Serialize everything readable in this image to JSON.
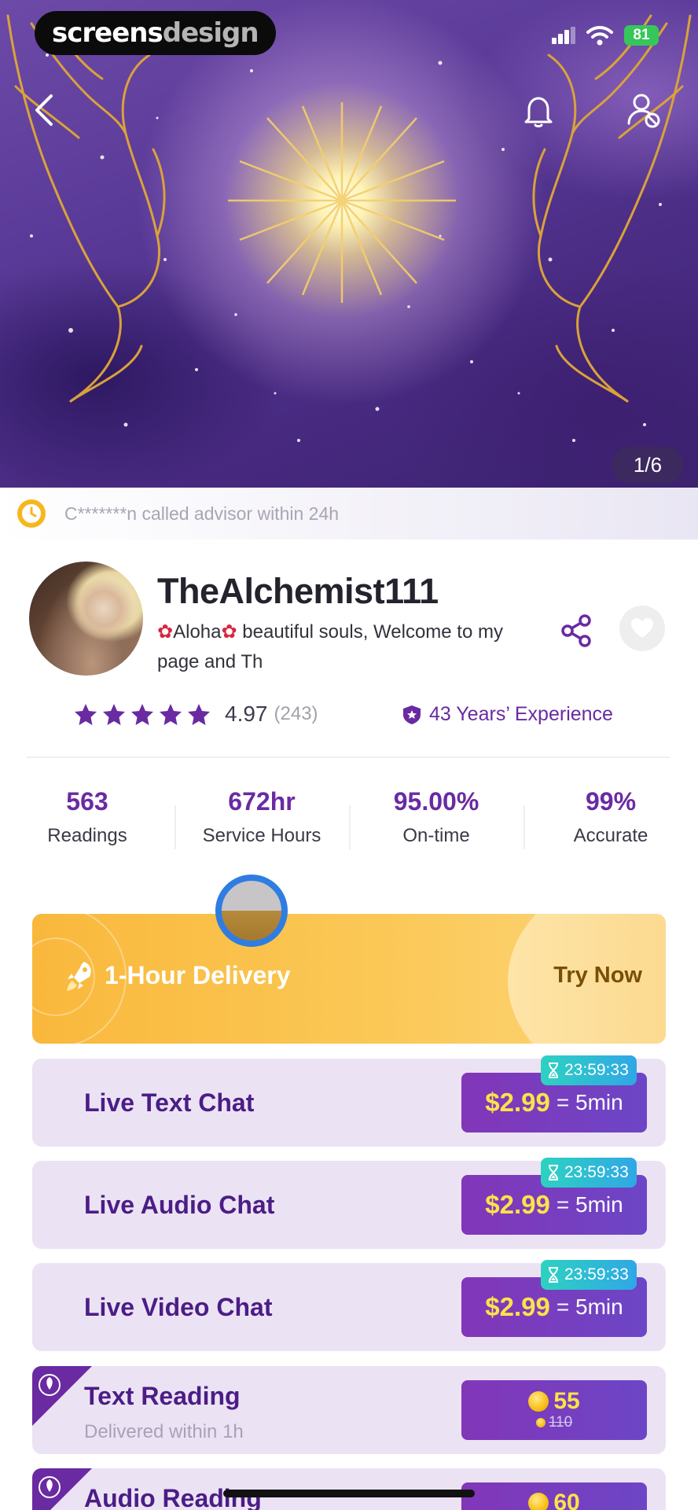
{
  "branding": {
    "part1": "screens",
    "part2": "design"
  },
  "status_bar": {
    "battery": "81"
  },
  "hero": {
    "counter": "1/6"
  },
  "notice": {
    "text": "C*******n called advisor within 24h"
  },
  "profile": {
    "name": "TheAlchemist111",
    "bio_prefix": "Aloha",
    "bio_text": " beautiful souls, Welcome to my page and Th",
    "rating": "4.97",
    "rating_count": "(243)",
    "experience": "43 Years’ Experience"
  },
  "stats": [
    {
      "value": "563",
      "label": "Readings"
    },
    {
      "value": "672hr",
      "label": "Service Hours"
    },
    {
      "value": "95.00%",
      "label": "On-time"
    },
    {
      "value": "99%",
      "label": "Accurate"
    }
  ],
  "delivery": {
    "title": "1-Hour Delivery",
    "cta": "Try Now"
  },
  "services": [
    {
      "label": "Live Text Chat",
      "price": "$2.99",
      "unit": "= 5min",
      "timer": "23:59:33"
    },
    {
      "label": "Live Audio Chat",
      "price": "$2.99",
      "unit": "= 5min",
      "timer": "23:59:33"
    },
    {
      "label": "Live Video Chat",
      "price": "$2.99",
      "unit": "= 5min",
      "timer": "23:59:33"
    }
  ],
  "readings": [
    {
      "label": "Text Reading",
      "sub": "Delivered within 1h",
      "coins": "55",
      "old_coins": "110"
    },
    {
      "label": "Audio Reading",
      "coins": "60"
    }
  ],
  "colors": {
    "accent": "#6a2aa2",
    "price_text": "#ffe24a",
    "delivery_orange": "#f9b83c",
    "timer_teal": "#2ed2c0"
  }
}
